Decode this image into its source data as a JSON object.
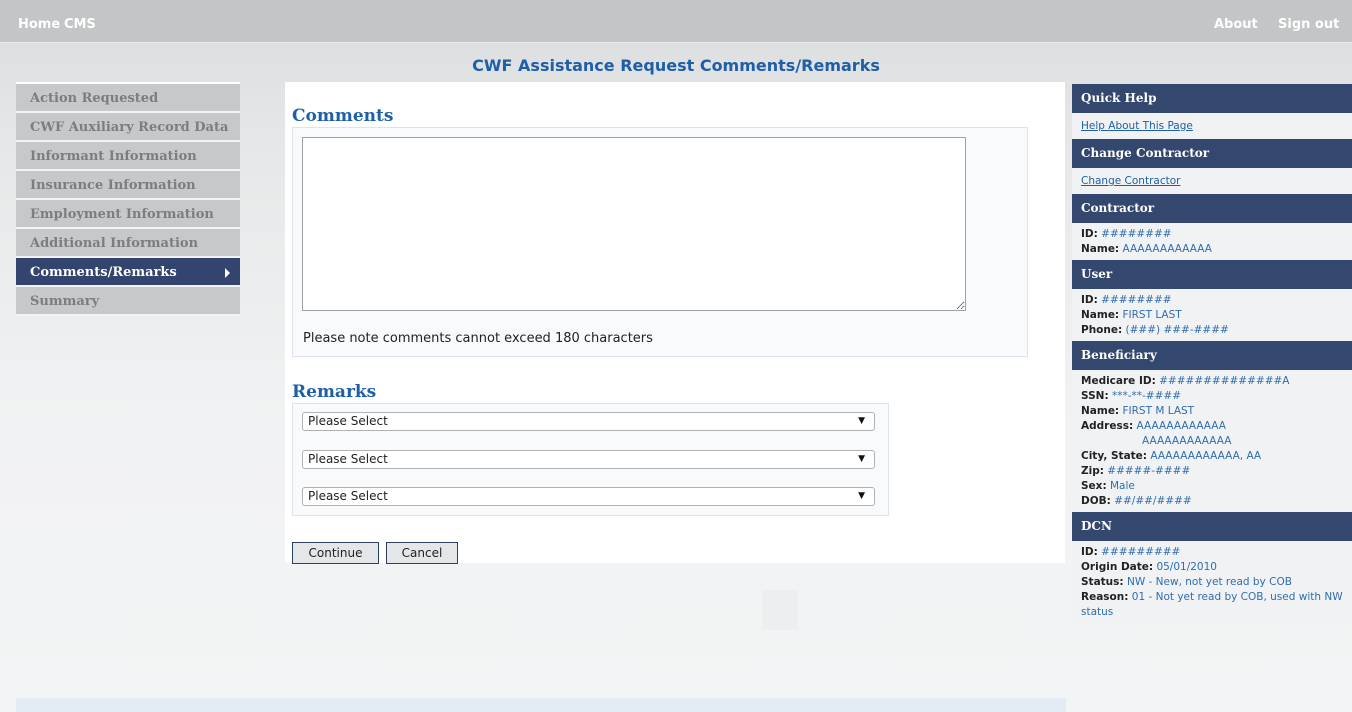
{
  "topnav": {
    "home": "Home",
    "cms": "CMS",
    "about": "About",
    "signout": "Sign out"
  },
  "page_title": "CWF Assistance Request Comments/Remarks",
  "leftnav": {
    "items": [
      {
        "label": "Action Requested"
      },
      {
        "label": "CWF Auxiliary Record Data"
      },
      {
        "label": "Informant Information"
      },
      {
        "label": "Insurance Information"
      },
      {
        "label": "Employment Information"
      },
      {
        "label": "Additional Information"
      },
      {
        "label": "Comments/Remarks",
        "active": true
      },
      {
        "label": "Summary"
      }
    ]
  },
  "comments": {
    "heading": "Comments",
    "textarea_value": "",
    "note": "Please note comments cannot exceed 180 characters"
  },
  "remarks": {
    "heading": "Remarks",
    "selects": [
      "Please Select",
      "Please Select",
      "Please Select"
    ]
  },
  "buttons": {
    "continue": "Continue",
    "cancel": "Cancel"
  },
  "right_panel": {
    "quick_help": {
      "heading": "Quick Help",
      "link": "Help About This Page"
    },
    "change_contractor": {
      "heading": "Change Contractor",
      "link": "Change Contractor"
    },
    "contractor": {
      "heading": "Contractor",
      "id_label": "ID:",
      "id": "########",
      "name_label": "Name:",
      "name": "AAAAAAAAAAAA"
    },
    "user": {
      "heading": "User",
      "id_label": "ID:",
      "id": "########",
      "name_label": "Name:",
      "name": "FIRST LAST",
      "phone_label": "Phone:",
      "phone": "(###) ###-####"
    },
    "beneficiary": {
      "heading": "Beneficiary",
      "medicare_label": "Medicare ID:",
      "medicare": "##############A",
      "ssn_label": "SSN:",
      "ssn": "***-**-####",
      "name_label": "Name:",
      "name": "FIRST M LAST",
      "address_label": "Address:",
      "address1": "AAAAAAAAAAAA",
      "address2": "AAAAAAAAAAAA",
      "city_label": "City, State:",
      "city": "AAAAAAAAAAAA, AA",
      "zip_label": "Zip:",
      "zip": "#####-####",
      "sex_label": "Sex:",
      "sex": "Male",
      "dob_label": "DOB:",
      "dob": "##/##/####"
    },
    "dcn": {
      "heading": "DCN",
      "id_label": "ID:",
      "id": "#########",
      "origin_label": "Origin Date:",
      "origin": "05/01/2010",
      "status_label": "Status:",
      "status": "NW - New, not yet read by COB",
      "reason_label": "Reason:",
      "reason": "01 - Not yet read by COB, used with NW status"
    }
  },
  "colors": {
    "nav_active": "#33456e",
    "panel_head": "#34486f",
    "link": "#1e5fa8"
  }
}
